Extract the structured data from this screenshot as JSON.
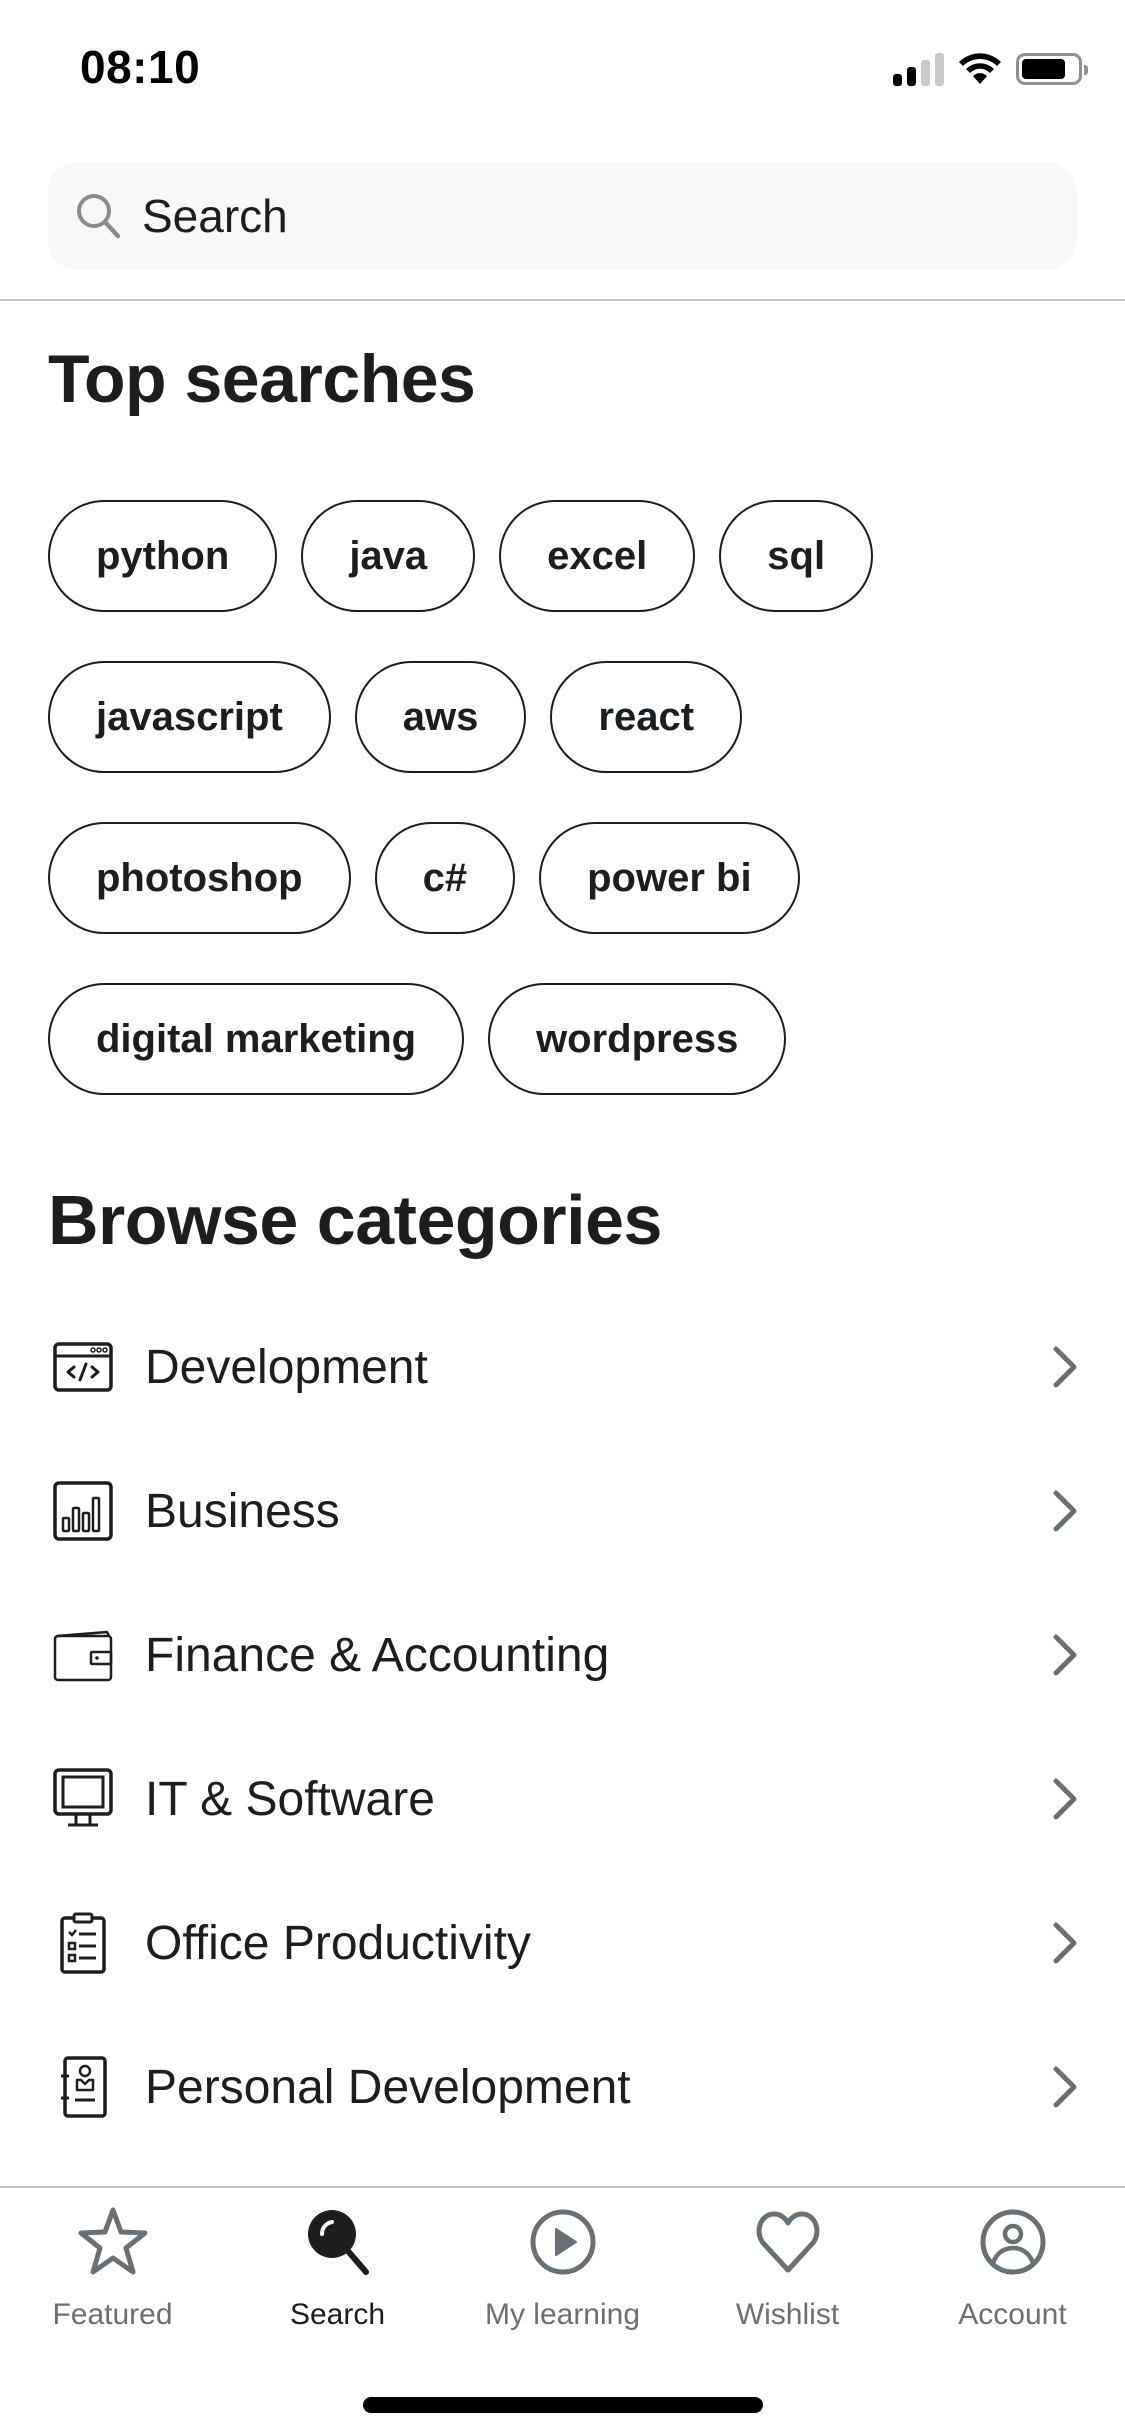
{
  "status_bar": {
    "time": "08:10",
    "signal_bars_active": 2,
    "signal_bars_total": 4,
    "battery_level_percent": 80,
    "icons": [
      "cellular-signal-icon",
      "wifi-icon",
      "battery-icon"
    ]
  },
  "search": {
    "placeholder": "Search",
    "value": "",
    "icon": "search-icon"
  },
  "top_searches": {
    "title": "Top searches",
    "rows": [
      [
        "python",
        "java",
        "excel",
        "sql"
      ],
      [
        "javascript",
        "aws",
        "react"
      ],
      [
        "photoshop",
        "c#",
        "power bi"
      ],
      [
        "digital marketing",
        "wordpress"
      ]
    ]
  },
  "browse_categories": {
    "title": "Browse categories",
    "items": [
      {
        "label": "Development",
        "icon": "code-window-icon"
      },
      {
        "label": "Business",
        "icon": "bar-chart-icon"
      },
      {
        "label": "Finance & Accounting",
        "icon": "wallet-icon"
      },
      {
        "label": "IT & Software",
        "icon": "monitor-icon"
      },
      {
        "label": "Office Productivity",
        "icon": "clipboard-checklist-icon"
      },
      {
        "label": "Personal Development",
        "icon": "profile-notebook-icon"
      }
    ],
    "chevron_icon": "chevron-right-icon"
  },
  "bottom_nav": {
    "active": "Search",
    "items": [
      {
        "label": "Featured",
        "icon": "star-icon"
      },
      {
        "label": "Search",
        "icon": "search-icon"
      },
      {
        "label": "My learning",
        "icon": "play-circle-icon"
      },
      {
        "label": "Wishlist",
        "icon": "heart-icon"
      },
      {
        "label": "Account",
        "icon": "account-circle-icon"
      }
    ]
  },
  "colors": {
    "text_primary": "#1c1d1f",
    "text_secondary": "#6a6f73",
    "search_bg": "#f7f8fa",
    "divider": "#c4c7ca"
  }
}
